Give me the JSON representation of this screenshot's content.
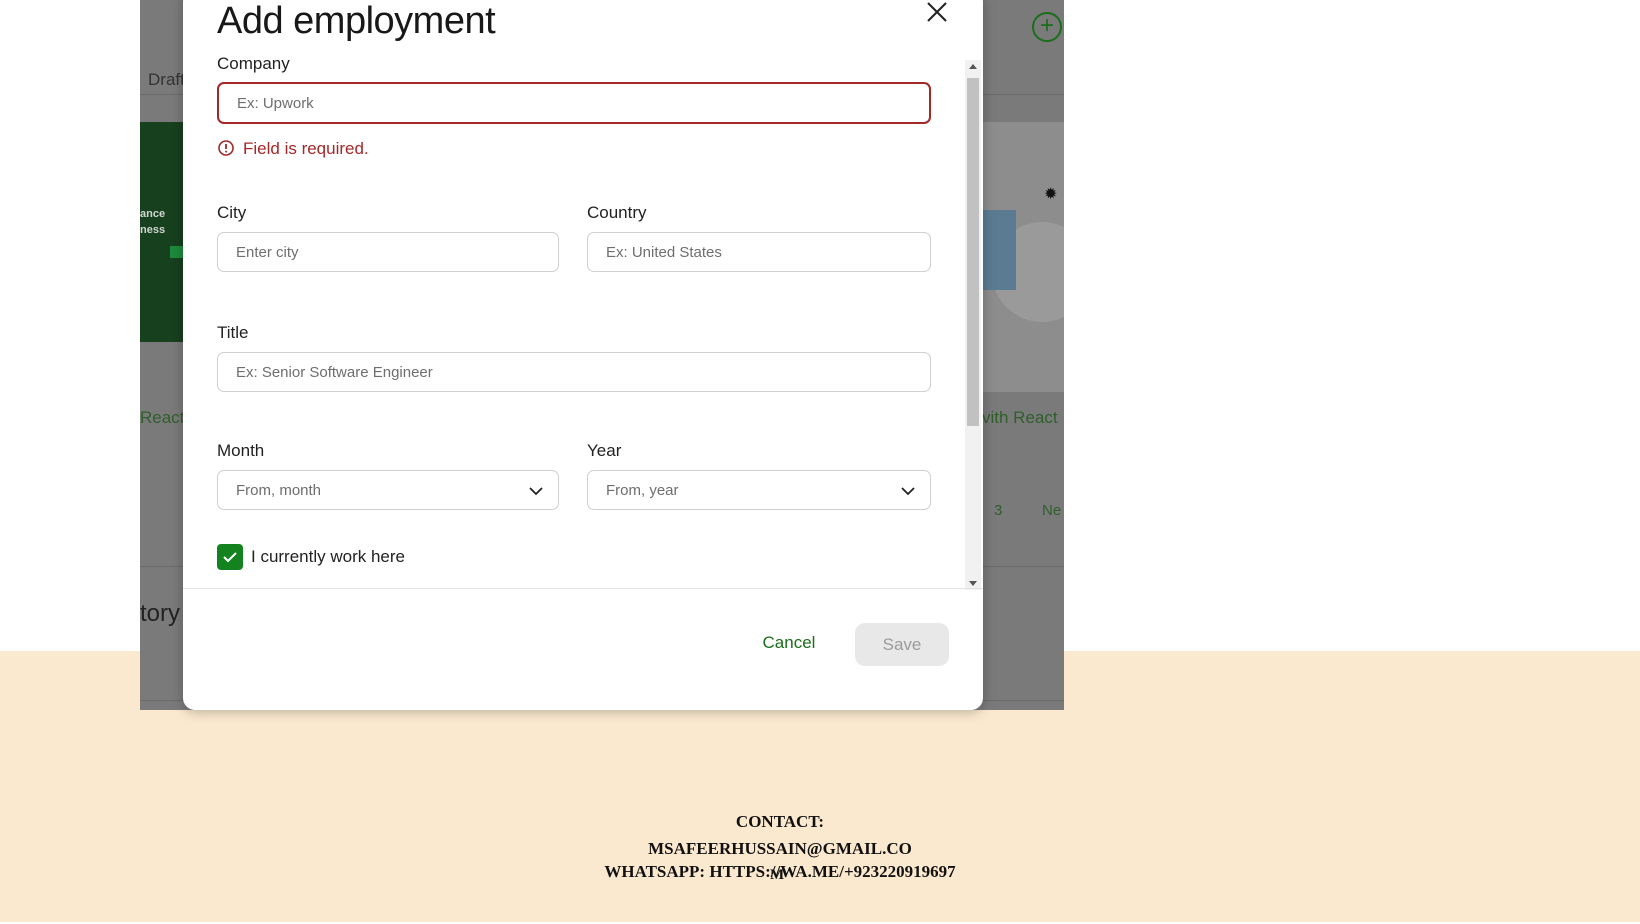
{
  "background_app": {
    "tab_drafts": "Draft",
    "card_left_line1": "ance",
    "card_left_line2": "ness",
    "card_left_title": "React",
    "card_right_title": "vith React",
    "pagination_page": "3",
    "pagination_next": "Ne",
    "section_heading": "tory"
  },
  "modal": {
    "title": "Add employment",
    "company": {
      "label": "Company",
      "placeholder": "Ex: Upwork",
      "error": "Field is required."
    },
    "city": {
      "label": "City",
      "placeholder": "Enter city"
    },
    "country": {
      "label": "Country",
      "placeholder": "Ex: United States"
    },
    "title_field": {
      "label": "Title",
      "placeholder": "Ex: Senior Software Engineer"
    },
    "month": {
      "label": "Month",
      "placeholder": "From, month"
    },
    "year": {
      "label": "Year",
      "placeholder": "From, year"
    },
    "current_checkbox": {
      "label": "I currently work here",
      "checked": true
    },
    "cancel_label": "Cancel",
    "save_label": "Save"
  },
  "contact": {
    "line1": "CONTACT:",
    "line2": "MSAFEERHUSSAIN@GMAIL.CO",
    "line3": "WHATSAPP: HTTPS://WA.ME/+923220919697",
    "line4": "M"
  },
  "colors": {
    "accent_green": "#14821e",
    "error_red": "#a52828",
    "overlay_grey": "#7a7a7a",
    "beige": "#fbe9cf"
  },
  "icons": [
    "close-icon",
    "error-icon",
    "chevron-down-icon",
    "check-icon",
    "plus-circle-icon"
  ]
}
